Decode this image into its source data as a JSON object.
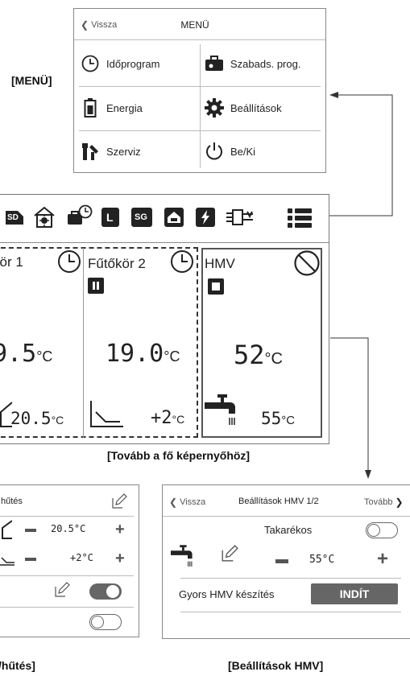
{
  "labels": {
    "menu_tag": "[MENÜ]",
    "main_caption": "[Tovább a fő képernyőhöz]",
    "left_caption": "/hűtés]",
    "right_caption": "[Beállítások HMV]"
  },
  "menu": {
    "back": "Vissza",
    "title": "MENÜ",
    "items": [
      {
        "label": "Időprogram",
        "icon": "clock-icon"
      },
      {
        "label": "Szabads. prog.",
        "icon": "suitcase-icon"
      },
      {
        "label": "Energia",
        "icon": "battery-icon"
      },
      {
        "label": "Beállítások",
        "icon": "gear-icon"
      },
      {
        "label": "Szerviz",
        "icon": "wrench-icon"
      },
      {
        "label": "Be/Ki",
        "icon": "power-icon"
      }
    ]
  },
  "status_bar": {
    "icons": [
      "sd-icon",
      "sun-house-icon",
      "schedule-icon",
      "l-icon",
      "sg-icon",
      "house-heat-icon",
      "bolt-icon",
      "heatpump-icon"
    ],
    "sd": "SD",
    "sg": "SG",
    "l": "L"
  },
  "zones": [
    {
      "name": "kör 1",
      "temp": "9.5",
      "unit": "°C",
      "setpoint": "20.5",
      "setpoint_unit": "°C"
    },
    {
      "name": "Fűtőkör 2",
      "temp": "19.0",
      "unit": "°C",
      "offset": "+2",
      "offset_unit": "°C"
    },
    {
      "name": "HMV",
      "temp": "52",
      "unit": "°C",
      "target": "55",
      "target_unit": "°C"
    }
  ],
  "left_panel": {
    "title": "hűtés",
    "row1_value": "20.5°C",
    "row2_value": "+2°C"
  },
  "right_panel": {
    "back": "Vissza",
    "title": "Beállítások HMV 1/2",
    "next": "Tovább",
    "eco_label": "Takarékos",
    "temp_value": "55°C",
    "quick_label": "Gyors HMV készítés",
    "start_button": "INDÍT"
  }
}
